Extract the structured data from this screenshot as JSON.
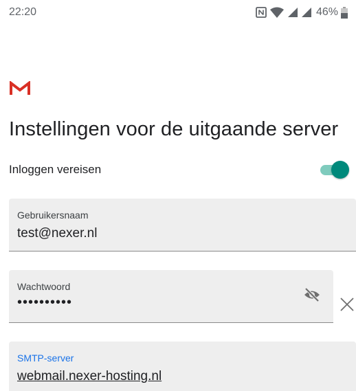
{
  "status_bar": {
    "time": "22:20",
    "battery": "46%"
  },
  "app": {
    "logo": "gmail-logo",
    "title": "Instellingen voor de uitgaande server"
  },
  "login_required": {
    "label": "Inloggen vereisen",
    "enabled": true,
    "accent_color": "#00897b"
  },
  "username": {
    "label": "Gebruikersnaam",
    "value": "test@nexer.nl"
  },
  "password": {
    "label": "Wachtwoord",
    "value": "••••••••••",
    "visibility_icon": "eye-off-icon",
    "clear_icon": "close-icon"
  },
  "smtp_server": {
    "label": "SMTP-server",
    "value": "webmail.nexer-hosting.nl",
    "label_color": "#1a73e8"
  }
}
